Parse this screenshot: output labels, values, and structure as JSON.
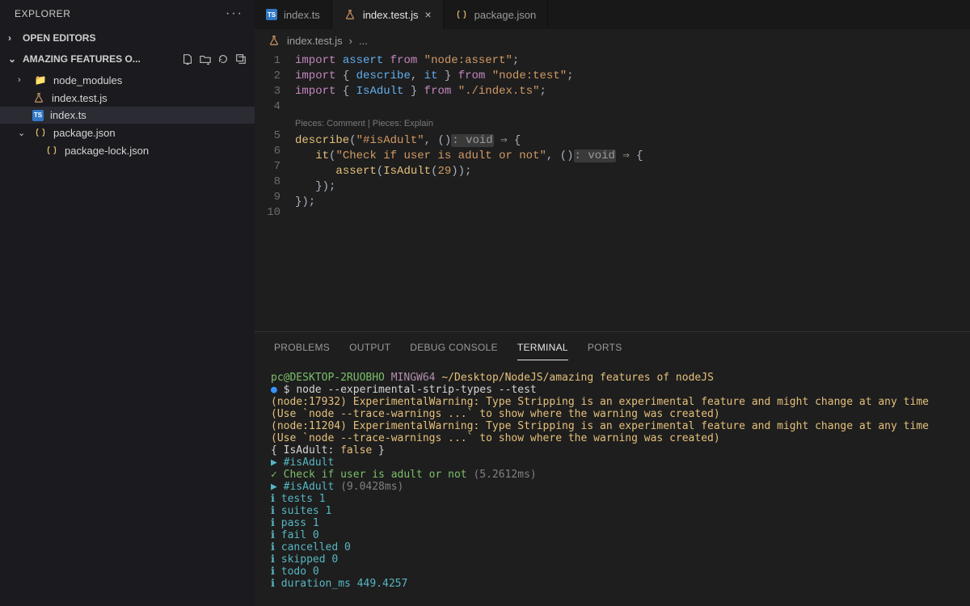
{
  "sidebar": {
    "title": "EXPLORER",
    "openEditors": "OPEN EDITORS",
    "workspace": "AMAZING FEATURES O...",
    "files": [
      {
        "name": "node_modules",
        "type": "folder"
      },
      {
        "name": "index.test.js",
        "type": "flask"
      },
      {
        "name": "index.ts",
        "type": "ts"
      },
      {
        "name": "package.json",
        "type": "json"
      },
      {
        "name": "package-lock.json",
        "type": "json"
      }
    ]
  },
  "tabs": [
    {
      "name": "index.ts",
      "type": "ts",
      "active": false
    },
    {
      "name": "index.test.js",
      "type": "flask",
      "active": true
    },
    {
      "name": "package.json",
      "type": "json",
      "active": false
    }
  ],
  "breadcrumb": {
    "file": "index.test.js",
    "sep": "›",
    "rest": "..."
  },
  "codelens": "Pieces: Comment | Pieces: Explain",
  "code": {
    "lines": [
      1,
      2,
      3,
      4,
      5,
      6,
      7,
      8,
      9,
      10
    ],
    "l1": {
      "import": "import",
      "assert": "assert",
      "from": "from",
      "module": "\"node:assert\"",
      "semi": ";"
    },
    "l2": {
      "import": "import",
      "brace_o": "{ ",
      "describe": "describe",
      "comma": ", ",
      "it": "it",
      "brace_c": " }",
      "from": "from",
      "module": "\"node:test\"",
      "semi": ";"
    },
    "l3": {
      "import": "import",
      "brace_o": "{ ",
      "isadult": "IsAdult",
      "brace_c": " }",
      "from": "from",
      "module": "\"./index.ts\"",
      "semi": ";"
    },
    "l5": {
      "describe": "describe",
      "po": "(",
      "str": "\"#isAdult\"",
      "comma": ", ",
      "paren": "()",
      "tyhint": ": void",
      "arrow": " ⇒ ",
      "brace": "{"
    },
    "l6": {
      "indent": "   ",
      "it": "it",
      "po": "(",
      "str": "\"Check if user is adult or not\"",
      "comma": ", ",
      "paren": "()",
      "tyhint": ": void",
      "arrow": " ⇒ ",
      "brace": "{"
    },
    "l7": {
      "indent": "      ",
      "assert": "assert",
      "po": "(",
      "isadult": "IsAdult",
      "po2": "(",
      "num": "29",
      "close": "));"
    },
    "l8": {
      "indent": "   ",
      "close": "});"
    },
    "l9": {
      "close": "});"
    }
  },
  "panel": {
    "tabs": [
      "PROBLEMS",
      "OUTPUT",
      "DEBUG CONSOLE",
      "TERMINAL",
      "PORTS"
    ],
    "active": "TERMINAL"
  },
  "terminal": {
    "prompt_user": "pc@DESKTOP-2RUOBHO",
    "prompt_shell": "MINGW64",
    "prompt_path": "~/Desktop/NodeJS/amazing features of nodeJS",
    "cmd_prefix": "$ ",
    "cmd": "node --experimental-strip-types --test",
    "warn1": "(node:17932) ExperimentalWarning: Type Stripping is an experimental feature and might change at any time",
    "warn_use": "(Use `node --trace-warnings ...` to show where the warning was created)",
    "warn2": "(node:11204) ExperimentalWarning: Type Stripping is an experimental feature and might change at any time",
    "obj": "{ IsAdult: ",
    "obj_val": "false",
    "obj_end": " }",
    "suite1": "▶ #isAdult",
    "passline": "  ✓ Check if user is adult or not ",
    "pass_time": "(5.2612ms)",
    "suite2": "▶ #isAdult ",
    "suite2_time": "(9.0428ms)",
    "stats": [
      "ℹ tests 1",
      "ℹ suites 1",
      "ℹ pass 1",
      "ℹ fail 0",
      "ℹ cancelled 0",
      "ℹ skipped 0",
      "ℹ todo 0",
      "ℹ duration_ms 449.4257"
    ]
  }
}
